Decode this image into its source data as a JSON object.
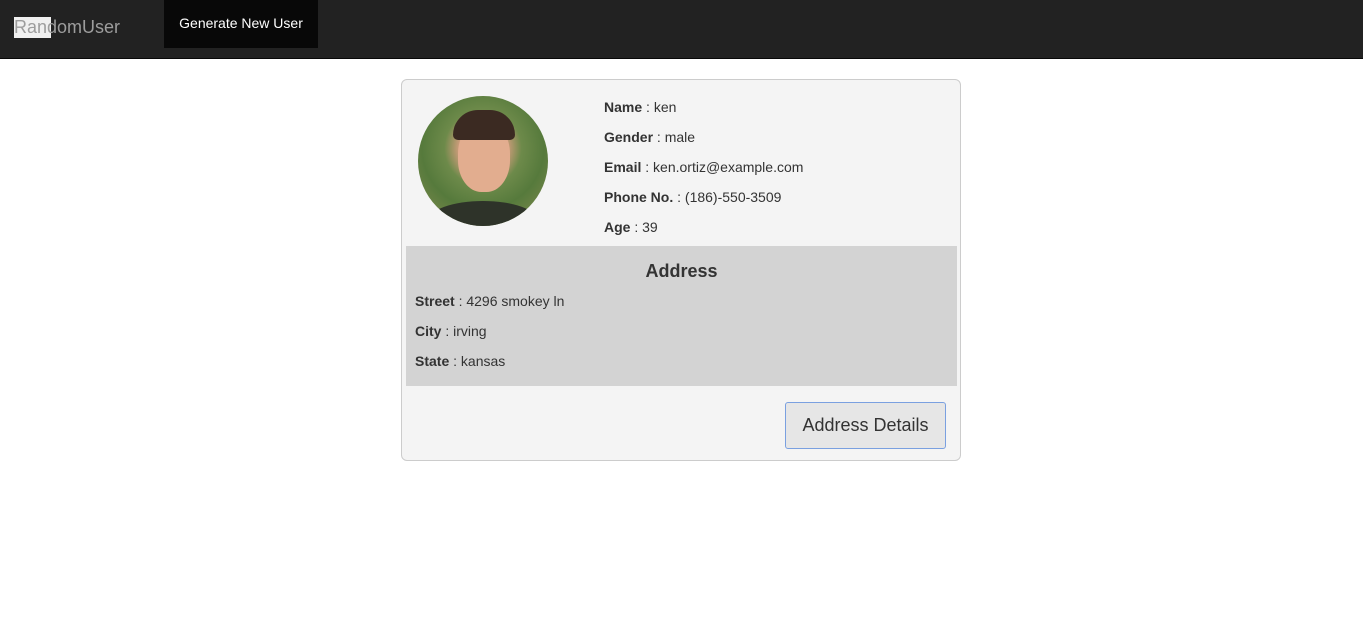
{
  "navbar": {
    "brand": "RandomUser",
    "generate_label": "Generate New User"
  },
  "user": {
    "fields": [
      {
        "label": "Name",
        "value": "ken"
      },
      {
        "label": "Gender",
        "value": "male"
      },
      {
        "label": "Email",
        "value": "ken.ortiz@example.com"
      },
      {
        "label": "Phone No.",
        "value": "(186)-550-3509"
      },
      {
        "label": "Age",
        "value": "39"
      }
    ],
    "address": {
      "title": "Address",
      "fields": [
        {
          "label": "Street",
          "value": "4296 smokey ln"
        },
        {
          "label": "City",
          "value": "irving"
        },
        {
          "label": "State",
          "value": "kansas"
        }
      ]
    },
    "details_button": "Address Details"
  }
}
